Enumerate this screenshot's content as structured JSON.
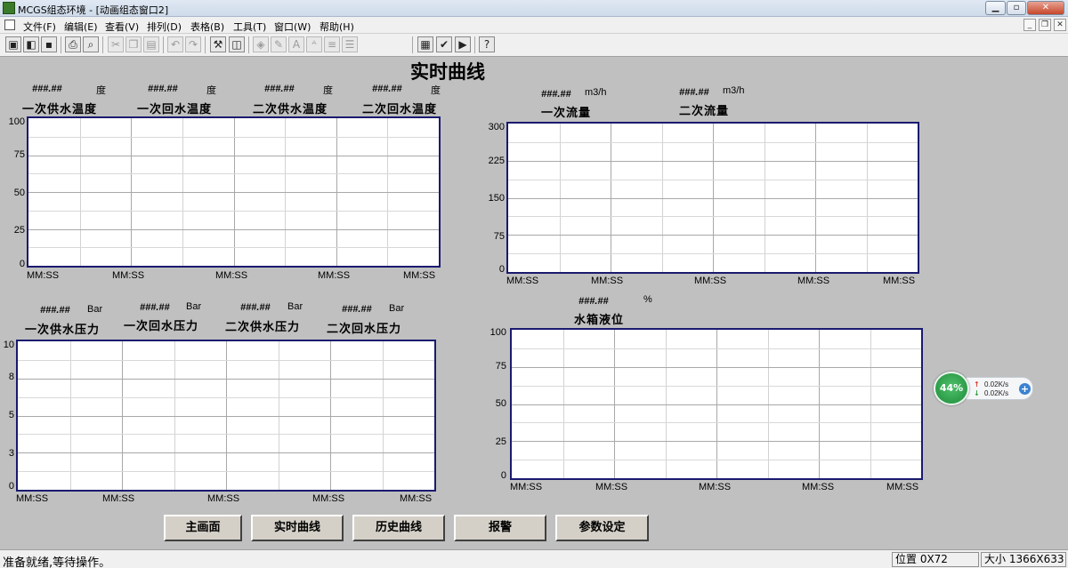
{
  "window": {
    "title": "MCGS组态环境 - [动画组态窗口2]"
  },
  "menu": [
    "文件(F)",
    "编辑(E)",
    "查看(V)",
    "排列(D)",
    "表格(B)",
    "工具(T)",
    "窗口(W)",
    "帮助(H)"
  ],
  "page_title": "实时曲线",
  "placeholder": "###.##",
  "time_label": "MM:SS",
  "charts": [
    {
      "id": "temperature",
      "variables": [
        {
          "caption": "一次供水温度",
          "unit": "度"
        },
        {
          "caption": "一次回水温度",
          "unit": "度"
        },
        {
          "caption": "二次供水温度",
          "unit": "度"
        },
        {
          "caption": "二次回水温度",
          "unit": "度"
        }
      ],
      "y_ticks": [
        "100",
        "75",
        "50",
        "25",
        "0"
      ],
      "ylim": [
        0,
        100
      ]
    },
    {
      "id": "flow",
      "variables": [
        {
          "caption": "一次流量",
          "unit": "m3/h"
        },
        {
          "caption": "二次流量",
          "unit": "m3/h"
        }
      ],
      "y_ticks": [
        "300",
        "225",
        "150",
        "75",
        "0"
      ],
      "ylim": [
        0,
        300
      ]
    },
    {
      "id": "pressure",
      "variables": [
        {
          "caption": "一次供水压力",
          "unit": "Bar"
        },
        {
          "caption": "一次回水压力",
          "unit": "Bar"
        },
        {
          "caption": "二次供水压力",
          "unit": "Bar"
        },
        {
          "caption": "二次回水压力",
          "unit": "Bar"
        }
      ],
      "y_ticks": [
        "10",
        "8",
        "5",
        "3",
        "0"
      ],
      "ylim": [
        0,
        10
      ]
    },
    {
      "id": "tank-level",
      "variables": [
        {
          "caption": "水箱液位",
          "unit": "%"
        }
      ],
      "y_ticks": [
        "100",
        "75",
        "50",
        "25",
        "0"
      ],
      "ylim": [
        0,
        100
      ]
    }
  ],
  "nav_buttons": [
    "主画面",
    "实时曲线",
    "历史曲线",
    "报警",
    "参数设定"
  ],
  "net_monitor": {
    "percent": "44%",
    "up": "0.02K/s",
    "down": "0.02K/s"
  },
  "status": {
    "message": "准备就绪,等待操作。",
    "position": "位置 0X72",
    "size": "大小 1366X633"
  }
}
